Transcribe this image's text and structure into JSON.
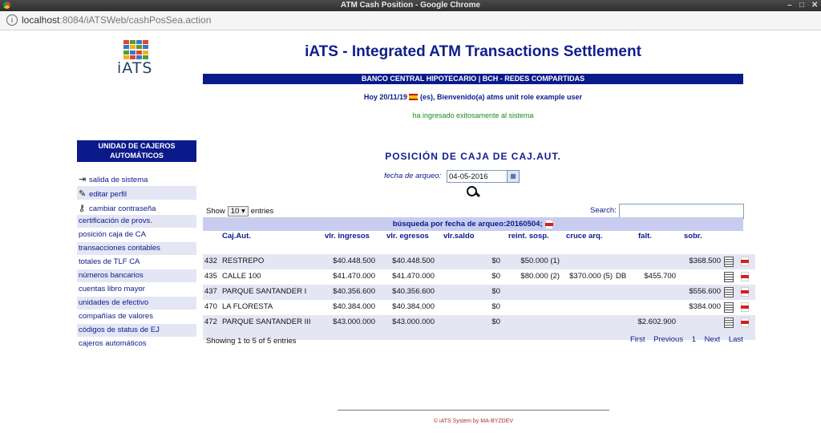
{
  "window": {
    "title": "ATM Cash Position - Google Chrome"
  },
  "browser": {
    "url_host": "localhost",
    "url_rest": ":8084/iATSWeb/cashPosSea.action"
  },
  "logo": {
    "text": "iATS"
  },
  "header": {
    "app_title": "iATS - Integrated ATM Transactions Settlement",
    "bank": "BANCO CENTRAL HIPOTECARIO | BCH - REDES COMPARTIDAS",
    "welcome_pre": "Hoy 20/11/19",
    "welcome_post": "(es), Bienvenido(a) atms unit role example user",
    "success": "ha ingresado exitosamente al sistema"
  },
  "sidebar": {
    "title": "UNIDAD DE CAJEROS AUTOMÁTICOS",
    "items": [
      {
        "label": "salida de sistema",
        "icon": "exit-icon"
      },
      {
        "label": "editar perfil",
        "icon": "edit-profile-icon"
      },
      {
        "label": "cambiar contraseña",
        "icon": "key-icon"
      },
      {
        "label": "certificación de provs."
      },
      {
        "label": "posición caja de CA"
      },
      {
        "label": "transacciones contables"
      },
      {
        "label": "totales de TLF CA"
      },
      {
        "label": "números bancarios"
      },
      {
        "label": "cuentas libro mayor"
      },
      {
        "label": "unidades de efectivo"
      },
      {
        "label": "compañías de valores"
      },
      {
        "label": "códigos de status de EJ"
      },
      {
        "label": "cajeros automáticos"
      }
    ]
  },
  "search": {
    "section_title": "POSICIÓN DE CAJA DE CAJ.AUT.",
    "date_label": "fecha de arqueo:",
    "date_value": "04-05-2016"
  },
  "table_controls": {
    "show_label": "Show",
    "show_value": "10",
    "entries_label": "entries",
    "search_label": "Search:",
    "group_label": "búsqueda por fecha de arqueo:20160504;",
    "showing": "Showing 1 to 5 of 5 entries",
    "pager": [
      "First",
      "Previous",
      "1",
      "Next",
      "Last"
    ]
  },
  "table": {
    "headers": [
      "Caj.Aut.",
      "vlr. ingresos",
      "vlr. egresos",
      "vlr.saldo",
      "reint. sosp.",
      "cruce arq.",
      "falt.",
      "sobr."
    ],
    "rows": [
      {
        "id": "432",
        "name": "RESTREPO",
        "ingresos": "$40.448.500",
        "egresos": "$40.448.500",
        "saldo": "$0",
        "reint": "$50.000 (1)",
        "cruce": "",
        "dbcr": "",
        "falt": "",
        "sobr": "$368.500"
      },
      {
        "id": "435",
        "name": "CALLE 100",
        "ingresos": "$41.470.000",
        "egresos": "$41.470.000",
        "saldo": "$0",
        "reint": "$80.000 (2)",
        "cruce": "$370.000 (5)",
        "dbcr": "DB",
        "falt": "$455.700",
        "sobr": ""
      },
      {
        "id": "437",
        "name": "PARQUE SANTANDER I",
        "ingresos": "$40.356.600",
        "egresos": "$40.356.600",
        "saldo": "$0",
        "reint": "",
        "cruce": "",
        "dbcr": "",
        "falt": "",
        "sobr": "$556.600"
      },
      {
        "id": "470",
        "name": "LA FLORESTA",
        "ingresos": "$40.384.000",
        "egresos": "$40.384.000",
        "saldo": "$0",
        "reint": "",
        "cruce": "",
        "dbcr": "",
        "falt": "",
        "sobr": "$384.000"
      },
      {
        "id": "472",
        "name": "PARQUE SANTANDER III",
        "ingresos": "$43.000.000",
        "egresos": "$43.000.000",
        "saldo": "$0",
        "reint": "",
        "cruce": "",
        "dbcr": "",
        "falt": "$2.602.900",
        "sobr": ""
      }
    ]
  },
  "footer": {
    "text": "© iATS System by MA-BYZDEV"
  }
}
